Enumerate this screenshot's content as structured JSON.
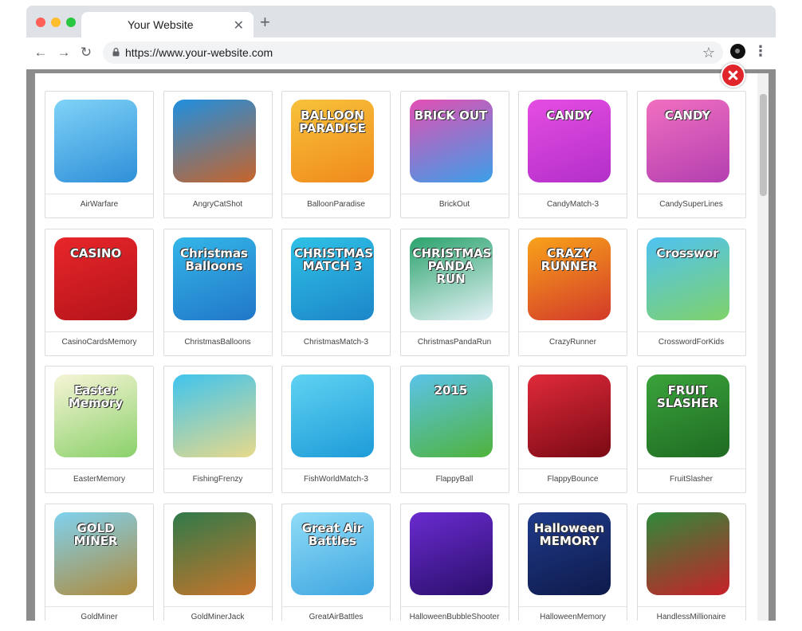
{
  "browser": {
    "tab_title": "Your Website",
    "tab_close": "✕",
    "new_tab": "+",
    "url": "https://www.your-website.com"
  },
  "games": [
    {
      "label": "AirWarfare",
      "icon": "airwarfare-icon",
      "colors": [
        "#7fd3f7",
        "#2f8fd8"
      ],
      "art": ""
    },
    {
      "label": "AngryCatShot",
      "icon": "angrycatshot-icon",
      "colors": [
        "#1f8fe0",
        "#c8642a"
      ],
      "art": ""
    },
    {
      "label": "BalloonParadise",
      "icon": "balloonparadise-icon",
      "colors": [
        "#f7c23b",
        "#f08a1c"
      ],
      "art": "BALLOON PARADISE"
    },
    {
      "label": "BrickOut",
      "icon": "brickout-icon",
      "colors": [
        "#e34fb3",
        "#3b9fe8"
      ],
      "art": "BRICK OUT"
    },
    {
      "label": "CandyMatch-3",
      "icon": "candymatch3-icon",
      "colors": [
        "#e54de2",
        "#b22fc9"
      ],
      "art": "CANDY"
    },
    {
      "label": "CandySuperLines",
      "icon": "candysuperlines-icon",
      "colors": [
        "#f06fc0",
        "#b33fb0"
      ],
      "art": "CANDY"
    },
    {
      "label": "CasinoCardsMemory",
      "icon": "casinocardsmemory-icon",
      "colors": [
        "#e8262a",
        "#b3141a"
      ],
      "art": "CASINO"
    },
    {
      "label": "ChristmasBalloons",
      "icon": "christmasballoons-icon",
      "colors": [
        "#34b6e8",
        "#2177c8"
      ],
      "art": "Christmas Balloons"
    },
    {
      "label": "ChristmasMatch-3",
      "icon": "christmasmatch3-icon",
      "colors": [
        "#2fc1e6",
        "#1c86c8"
      ],
      "art": "CHRISTMAS MATCH 3"
    },
    {
      "label": "ChristmasPandaRun",
      "icon": "christmaspandarun-icon",
      "colors": [
        "#2aa36c",
        "#e6f2f7"
      ],
      "art": "CHRISTMAS PANDA RUN"
    },
    {
      "label": "CrazyRunner",
      "icon": "crazyrunner-icon",
      "colors": [
        "#f8a21a",
        "#d33a2a"
      ],
      "art": "CRAZY RUNNER"
    },
    {
      "label": "CrosswordForKids",
      "icon": "crosswordforkids-icon",
      "colors": [
        "#4fc2f2",
        "#7fd26a"
      ],
      "art": "Crosswor"
    },
    {
      "label": "EasterMemory",
      "icon": "eastermemory-icon",
      "colors": [
        "#f7f4d6",
        "#8ad16a"
      ],
      "art": "Easter Memory"
    },
    {
      "label": "FishingFrenzy",
      "icon": "fishingfrenzy-icon",
      "colors": [
        "#3fc4ee",
        "#e8d98a"
      ],
      "art": ""
    },
    {
      "label": "FishWorldMatch-3",
      "icon": "fishworldmatch3-icon",
      "colors": [
        "#5fd3f2",
        "#1e9bd8"
      ],
      "art": ""
    },
    {
      "label": "FlappyBall",
      "icon": "flappyball-icon",
      "colors": [
        "#5bc3ea",
        "#4fb33b"
      ],
      "art": "2015"
    },
    {
      "label": "FlappyBounce",
      "icon": "flappybounce-icon",
      "colors": [
        "#e02a3a",
        "#7a0a14"
      ],
      "art": ""
    },
    {
      "label": "FruitSlasher",
      "icon": "fruitslasher-icon",
      "colors": [
        "#3aa33b",
        "#1f6b22"
      ],
      "art": "FRUIT SLASHER"
    },
    {
      "label": "GoldMiner",
      "icon": "goldminer-icon",
      "colors": [
        "#7fd2f0",
        "#b08a3a"
      ],
      "art": "GOLD MINER"
    },
    {
      "label": "GoldMinerJack",
      "icon": "goldminerjack-icon",
      "colors": [
        "#2f7a4a",
        "#c8742a"
      ],
      "art": ""
    },
    {
      "label": "GreatAirBattles",
      "icon": "greatairbattles-icon",
      "colors": [
        "#8fdcf7",
        "#3fa6e0"
      ],
      "art": "Great Air Battles"
    },
    {
      "label": "HalloweenBubbleShooter",
      "icon": "halloweenbubbleshooter-icon",
      "colors": [
        "#6a2bd0",
        "#2a0f6a"
      ],
      "art": ""
    },
    {
      "label": "HalloweenMemory",
      "icon": "halloweenmemory-icon",
      "colors": [
        "#1f3a8a",
        "#0e1a4a"
      ],
      "art": "Halloween MEMORY"
    },
    {
      "label": "HandlessMillionaire",
      "icon": "handlessmillionaire-icon",
      "colors": [
        "#2e8a3a",
        "#c8202a"
      ],
      "art": ""
    }
  ]
}
